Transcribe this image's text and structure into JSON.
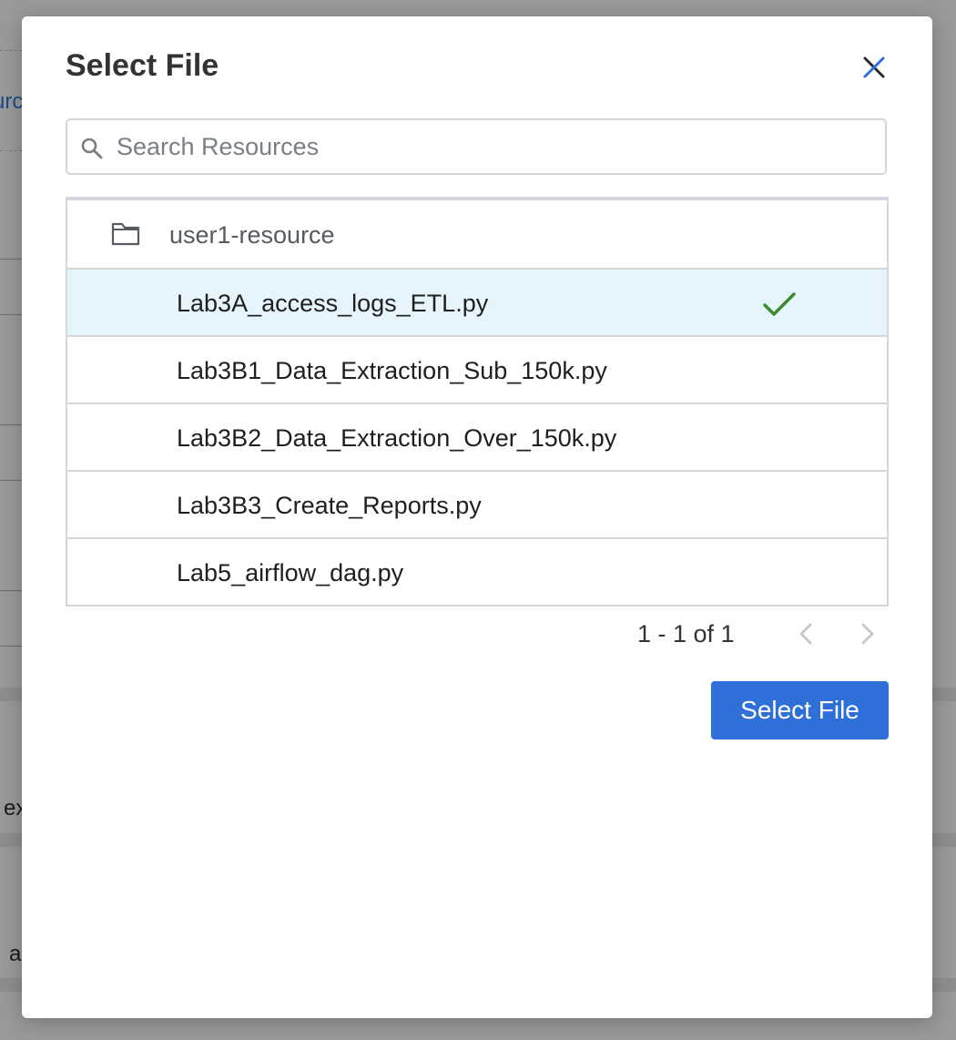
{
  "background": {
    "fragments": [
      {
        "text": "urc",
        "kind": "link"
      },
      {
        "text": "ex",
        "kind": "text"
      },
      {
        "text": "a",
        "kind": "text"
      }
    ]
  },
  "modal": {
    "title": "Select File",
    "close_icon": "close-icon"
  },
  "search": {
    "placeholder": "Search Resources",
    "value": "",
    "icon": "search-icon"
  },
  "file_list": {
    "folder": {
      "label": "user1-resource",
      "icon": "folder-icon"
    },
    "files": [
      {
        "name": "Lab3A_access_logs_ETL.py",
        "selected": true
      },
      {
        "name": "Lab3B1_Data_Extraction_Sub_150k.py",
        "selected": false
      },
      {
        "name": "Lab3B2_Data_Extraction_Over_150k.py",
        "selected": false
      },
      {
        "name": "Lab3B3_Create_Reports.py",
        "selected": false
      },
      {
        "name": "Lab5_airflow_dag.py",
        "selected": false
      }
    ]
  },
  "pagination": {
    "range_text": "1 - 1 of 1",
    "prev_icon": "chevron-left-icon",
    "next_icon": "chevron-right-icon"
  },
  "actions": {
    "select_label": "Select File"
  },
  "colors": {
    "accent": "#2e6fd8",
    "selected_row": "#e6f4fb",
    "check": "#3d8b2f",
    "overlay": "#9a9a9a"
  }
}
